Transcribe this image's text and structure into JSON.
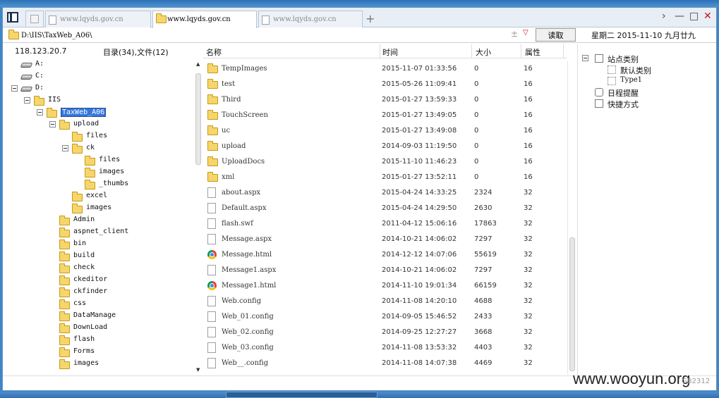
{
  "tabs": [
    {
      "label": "www.lqyds.gov.cn",
      "active": false,
      "icon": "page-icon"
    },
    {
      "label": "www.lqyds.gov.cn",
      "active": true,
      "icon": "folder-icon"
    },
    {
      "label": "www.lqyds.gov.cn",
      "active": false,
      "icon": "page-icon"
    }
  ],
  "new_tab": "+",
  "window_controls": {
    "more": "›",
    "minimize": "—",
    "maximize": "□",
    "close": "✕"
  },
  "address": {
    "path": "D:\\IIS\\TaxWeb_A06\\",
    "arrows": "±",
    "dropdown": "▽",
    "read_button": "读取"
  },
  "date_text": "星期二 2015-11-10 九月廿九",
  "left_header": {
    "ip": "118.123.20.7",
    "count": "目录(34),文件(12)"
  },
  "tree": [
    {
      "label": "A:",
      "level": 0,
      "type": "drive",
      "expand": false
    },
    {
      "label": "C:",
      "level": 0,
      "type": "drive",
      "expand": false
    },
    {
      "label": "D:",
      "level": 0,
      "type": "drive",
      "expand": true
    },
    {
      "label": "IIS",
      "level": 1,
      "type": "folder",
      "expand": true
    },
    {
      "label": "TaxWeb_A06",
      "level": 2,
      "type": "folder",
      "expand": true,
      "selected": true
    },
    {
      "label": "upload",
      "level": 3,
      "type": "folder",
      "expand": true
    },
    {
      "label": "files",
      "level": 4,
      "type": "folder",
      "expand": false
    },
    {
      "label": "ck",
      "level": 4,
      "type": "folder",
      "expand": true
    },
    {
      "label": "files",
      "level": 5,
      "type": "folder",
      "expand": false
    },
    {
      "label": "images",
      "level": 5,
      "type": "folder",
      "expand": false
    },
    {
      "label": "_thumbs",
      "level": 5,
      "type": "folder",
      "expand": false
    },
    {
      "label": "excel",
      "level": 4,
      "type": "folder",
      "expand": false
    },
    {
      "label": "images",
      "level": 4,
      "type": "folder",
      "expand": false
    },
    {
      "label": "Admin",
      "level": 3,
      "type": "folder",
      "expand": false
    },
    {
      "label": "aspnet_client",
      "level": 3,
      "type": "folder",
      "expand": false
    },
    {
      "label": "bin",
      "level": 3,
      "type": "folder",
      "expand": false
    },
    {
      "label": "build",
      "level": 3,
      "type": "folder",
      "expand": false
    },
    {
      "label": "check",
      "level": 3,
      "type": "folder",
      "expand": false
    },
    {
      "label": "ckeditor",
      "level": 3,
      "type": "folder",
      "expand": false
    },
    {
      "label": "ckfinder",
      "level": 3,
      "type": "folder",
      "expand": false
    },
    {
      "label": "css",
      "level": 3,
      "type": "folder",
      "expand": false
    },
    {
      "label": "DataManage",
      "level": 3,
      "type": "folder",
      "expand": false
    },
    {
      "label": "DownLoad",
      "level": 3,
      "type": "folder",
      "expand": false
    },
    {
      "label": "flash",
      "level": 3,
      "type": "folder",
      "expand": false
    },
    {
      "label": "Forms",
      "level": 3,
      "type": "folder",
      "expand": false
    },
    {
      "label": "images",
      "level": 3,
      "type": "folder",
      "expand": false
    }
  ],
  "file_columns": {
    "name": "名称",
    "time": "时间",
    "size": "大小",
    "attr": "属性"
  },
  "files": [
    {
      "name": "TempImages",
      "time": "2015-11-07 01:33:56",
      "size": "0",
      "attr": "16",
      "type": "folder"
    },
    {
      "name": "test",
      "time": "2015-05-26 11:09:41",
      "size": "0",
      "attr": "16",
      "type": "folder"
    },
    {
      "name": "Third",
      "time": "2015-01-27 13:59:33",
      "size": "0",
      "attr": "16",
      "type": "folder"
    },
    {
      "name": "TouchScreen",
      "time": "2015-01-27 13:49:05",
      "size": "0",
      "attr": "16",
      "type": "folder"
    },
    {
      "name": "uc",
      "time": "2015-01-27 13:49:08",
      "size": "0",
      "attr": "16",
      "type": "folder"
    },
    {
      "name": "upload",
      "time": "2014-09-03 11:19:50",
      "size": "0",
      "attr": "16",
      "type": "folder"
    },
    {
      "name": "UploadDocs",
      "time": "2015-11-10 11:46:23",
      "size": "0",
      "attr": "16",
      "type": "folder"
    },
    {
      "name": "xml",
      "time": "2015-01-27 13:52:11",
      "size": "0",
      "attr": "16",
      "type": "folder"
    },
    {
      "name": "about.aspx",
      "time": "2015-04-24 14:33:25",
      "size": "2324",
      "attr": "32",
      "type": "file"
    },
    {
      "name": "Default.aspx",
      "time": "2015-04-24 14:29:50",
      "size": "2630",
      "attr": "32",
      "type": "file"
    },
    {
      "name": "flash.swf",
      "time": "2011-04-12 15:06:16",
      "size": "17863",
      "attr": "32",
      "type": "file"
    },
    {
      "name": "Message.aspx",
      "time": "2014-10-21 14:06:02",
      "size": "7297",
      "attr": "32",
      "type": "file"
    },
    {
      "name": "Message.html",
      "time": "2014-12-12 14:07:06",
      "size": "55619",
      "attr": "32",
      "type": "chrome"
    },
    {
      "name": "Message1.aspx",
      "time": "2014-10-21 14:06:02",
      "size": "7297",
      "attr": "32",
      "type": "file"
    },
    {
      "name": "Message1.html",
      "time": "2014-11-10 19:01:34",
      "size": "66159",
      "attr": "32",
      "type": "chrome"
    },
    {
      "name": "Web.config",
      "time": "2014-11-08 14:20:10",
      "size": "4688",
      "attr": "32",
      "type": "file"
    },
    {
      "name": "Web_01.config",
      "time": "2014-09-05 15:46:52",
      "size": "2433",
      "attr": "32",
      "type": "file"
    },
    {
      "name": "Web_02.config",
      "time": "2014-09-25 12:27:27",
      "size": "3668",
      "attr": "32",
      "type": "file"
    },
    {
      "name": "Web_03.config",
      "time": "2014-11-08 13:53:32",
      "size": "4403",
      "attr": "32",
      "type": "file"
    },
    {
      "name": "Web__.config",
      "time": "2014-11-08 14:07:38",
      "size": "4469",
      "attr": "32",
      "type": "file"
    }
  ],
  "right_pane": {
    "site_category": "站点类别",
    "default_category": "默认类别",
    "type1": "Type1",
    "schedule": "日程提醒",
    "shortcuts": "快捷方式"
  },
  "watermark": "www.wooyun.org",
  "status_code": "GB2312"
}
